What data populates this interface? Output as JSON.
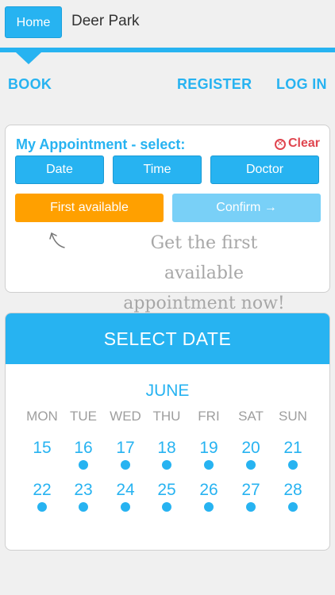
{
  "header": {
    "home_label": "Home",
    "title": "Deer Park"
  },
  "nav": {
    "book": "BOOK",
    "register": "REGISTER",
    "login": "LOG IN"
  },
  "appointment": {
    "title": "My Appointment - select:",
    "clear_label": "Clear",
    "date_label": "Date",
    "time_label": "Time",
    "doctor_label": "Doctor",
    "first_available_label": "First available",
    "confirm_label": "Confirm →",
    "hint_line1": "Get the first available",
    "hint_line2": "appointment now!"
  },
  "calendar": {
    "header": "SELECT DATE",
    "month": "JUNE",
    "weekdays": [
      "MON",
      "TUE",
      "WED",
      "THU",
      "FRI",
      "SAT",
      "SUN"
    ],
    "week1": [
      "15",
      "16",
      "17",
      "18",
      "19",
      "20",
      "21"
    ],
    "week2": [
      "22",
      "23",
      "24",
      "25",
      "26",
      "27",
      "28"
    ]
  },
  "colors": {
    "accent": "#27b3f1",
    "orange": "#ffa000",
    "clear_red": "#e0454f"
  },
  "icons": {
    "clear": "close-circle-icon",
    "hint": "curved-arrow-icon"
  }
}
